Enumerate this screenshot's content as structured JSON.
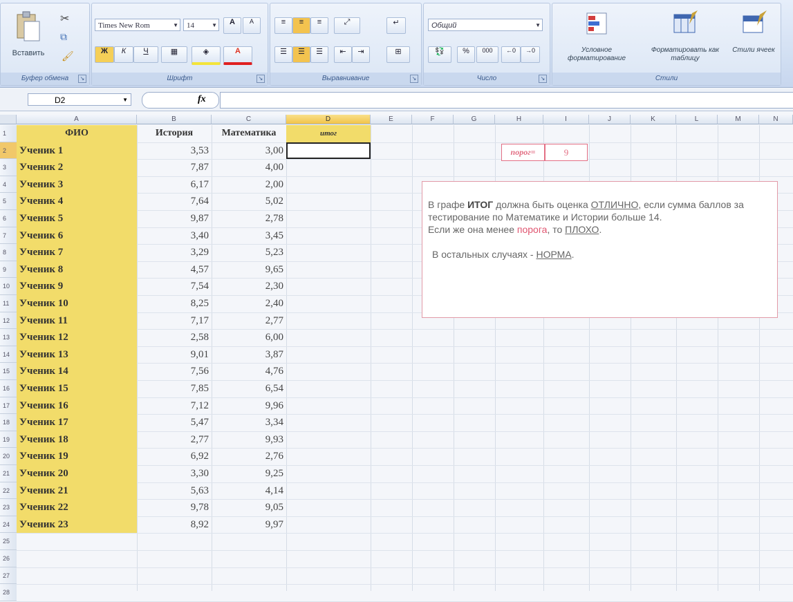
{
  "ribbon": {
    "clipboard": {
      "group_label": "Буфер обмена",
      "paste_label": "Вставить"
    },
    "font": {
      "group_label": "Шрифт",
      "font_name": "Times New Rom",
      "font_size": "14",
      "grow": "A",
      "shrink": "A",
      "bold": "Ж",
      "italic": "К",
      "underline": "Ч",
      "font_color_letter": "A"
    },
    "alignment": {
      "group_label": "Выравнивание"
    },
    "number": {
      "group_label": "Число",
      "format": "Общий",
      "percent": "%",
      "thousands": "000"
    },
    "styles": {
      "group_label": "Стили",
      "conditional_label": "Условное форматирование",
      "format_table_label": "Форматировать как таблицу",
      "cell_styles_label": "Стили ячеек"
    }
  },
  "formula_bar": {
    "name_box": "D2",
    "fx": "fx",
    "formula": ""
  },
  "columns": [
    "A",
    "B",
    "C",
    "D",
    "E",
    "F",
    "G",
    "H",
    "I",
    "J",
    "K",
    "L",
    "M",
    "N"
  ],
  "headers": {
    "fio": "ФИО",
    "history": "История",
    "math": "Математика",
    "itog": "итог"
  },
  "rows": [
    {
      "n": "2",
      "name": "Ученик 1",
      "h": "3,53",
      "m": "3,00"
    },
    {
      "n": "3",
      "name": "Ученик 2",
      "h": "7,87",
      "m": "4,00"
    },
    {
      "n": "4",
      "name": "Ученик 3",
      "h": "6,17",
      "m": "2,00"
    },
    {
      "n": "5",
      "name": "Ученик 4",
      "h": "7,64",
      "m": "5,02"
    },
    {
      "n": "6",
      "name": "Ученик 5",
      "h": "9,87",
      "m": "2,78"
    },
    {
      "n": "7",
      "name": "Ученик 6",
      "h": "3,40",
      "m": "3,45"
    },
    {
      "n": "8",
      "name": "Ученик 7",
      "h": "3,29",
      "m": "5,23"
    },
    {
      "n": "9",
      "name": "Ученик 8",
      "h": "4,57",
      "m": "9,65"
    },
    {
      "n": "10",
      "name": "Ученик 9",
      "h": "7,54",
      "m": "2,30"
    },
    {
      "n": "11",
      "name": "Ученик 10",
      "h": "8,25",
      "m": "2,40"
    },
    {
      "n": "12",
      "name": "Ученик 11",
      "h": "7,17",
      "m": "2,77"
    },
    {
      "n": "13",
      "name": "Ученик 12",
      "h": "2,58",
      "m": "6,00"
    },
    {
      "n": "14",
      "name": "Ученик 13",
      "h": "9,01",
      "m": "3,87"
    },
    {
      "n": "15",
      "name": "Ученик 14",
      "h": "7,56",
      "m": "4,76"
    },
    {
      "n": "16",
      "name": "Ученик 15",
      "h": "7,85",
      "m": "6,54"
    },
    {
      "n": "17",
      "name": "Ученик 16",
      "h": "7,12",
      "m": "9,96"
    },
    {
      "n": "18",
      "name": "Ученик 17",
      "h": "5,47",
      "m": "3,34"
    },
    {
      "n": "19",
      "name": "Ученик 18",
      "h": "2,77",
      "m": "9,93"
    },
    {
      "n": "20",
      "name": "Ученик 19",
      "h": "6,92",
      "m": "2,76"
    },
    {
      "n": "21",
      "name": "Ученик 20",
      "h": "3,30",
      "m": "9,25"
    },
    {
      "n": "22",
      "name": "Ученик 21",
      "h": "5,63",
      "m": "4,14"
    },
    {
      "n": "23",
      "name": "Ученик 22",
      "h": "9,78",
      "m": "9,05"
    },
    {
      "n": "24",
      "name": "Ученик 23",
      "h": "8,92",
      "m": "9,97"
    }
  ],
  "extra_rows": [
    "1",
    "25",
    "26",
    "27",
    "28"
  ],
  "threshold": {
    "label": "порог=",
    "value": "9"
  },
  "note": {
    "line1_pre": "В графе ",
    "line1_bold": "ИТОГ",
    "line1_mid": " должна быть оценка ",
    "line1_u": "ОТЛИЧНО",
    "line1_post": ", если сумма баллов за тестирование по Математике и Истории больше 14.",
    "line2_pre": "Если же она менее ",
    "line2_red": "порога",
    "line2_mid": ", то ",
    "line2_u": "ПЛОХО",
    "line2_post": ".",
    "line3_pre": "В остальных случаях - ",
    "line3_u": "НОРМА",
    "line3_post": "."
  }
}
